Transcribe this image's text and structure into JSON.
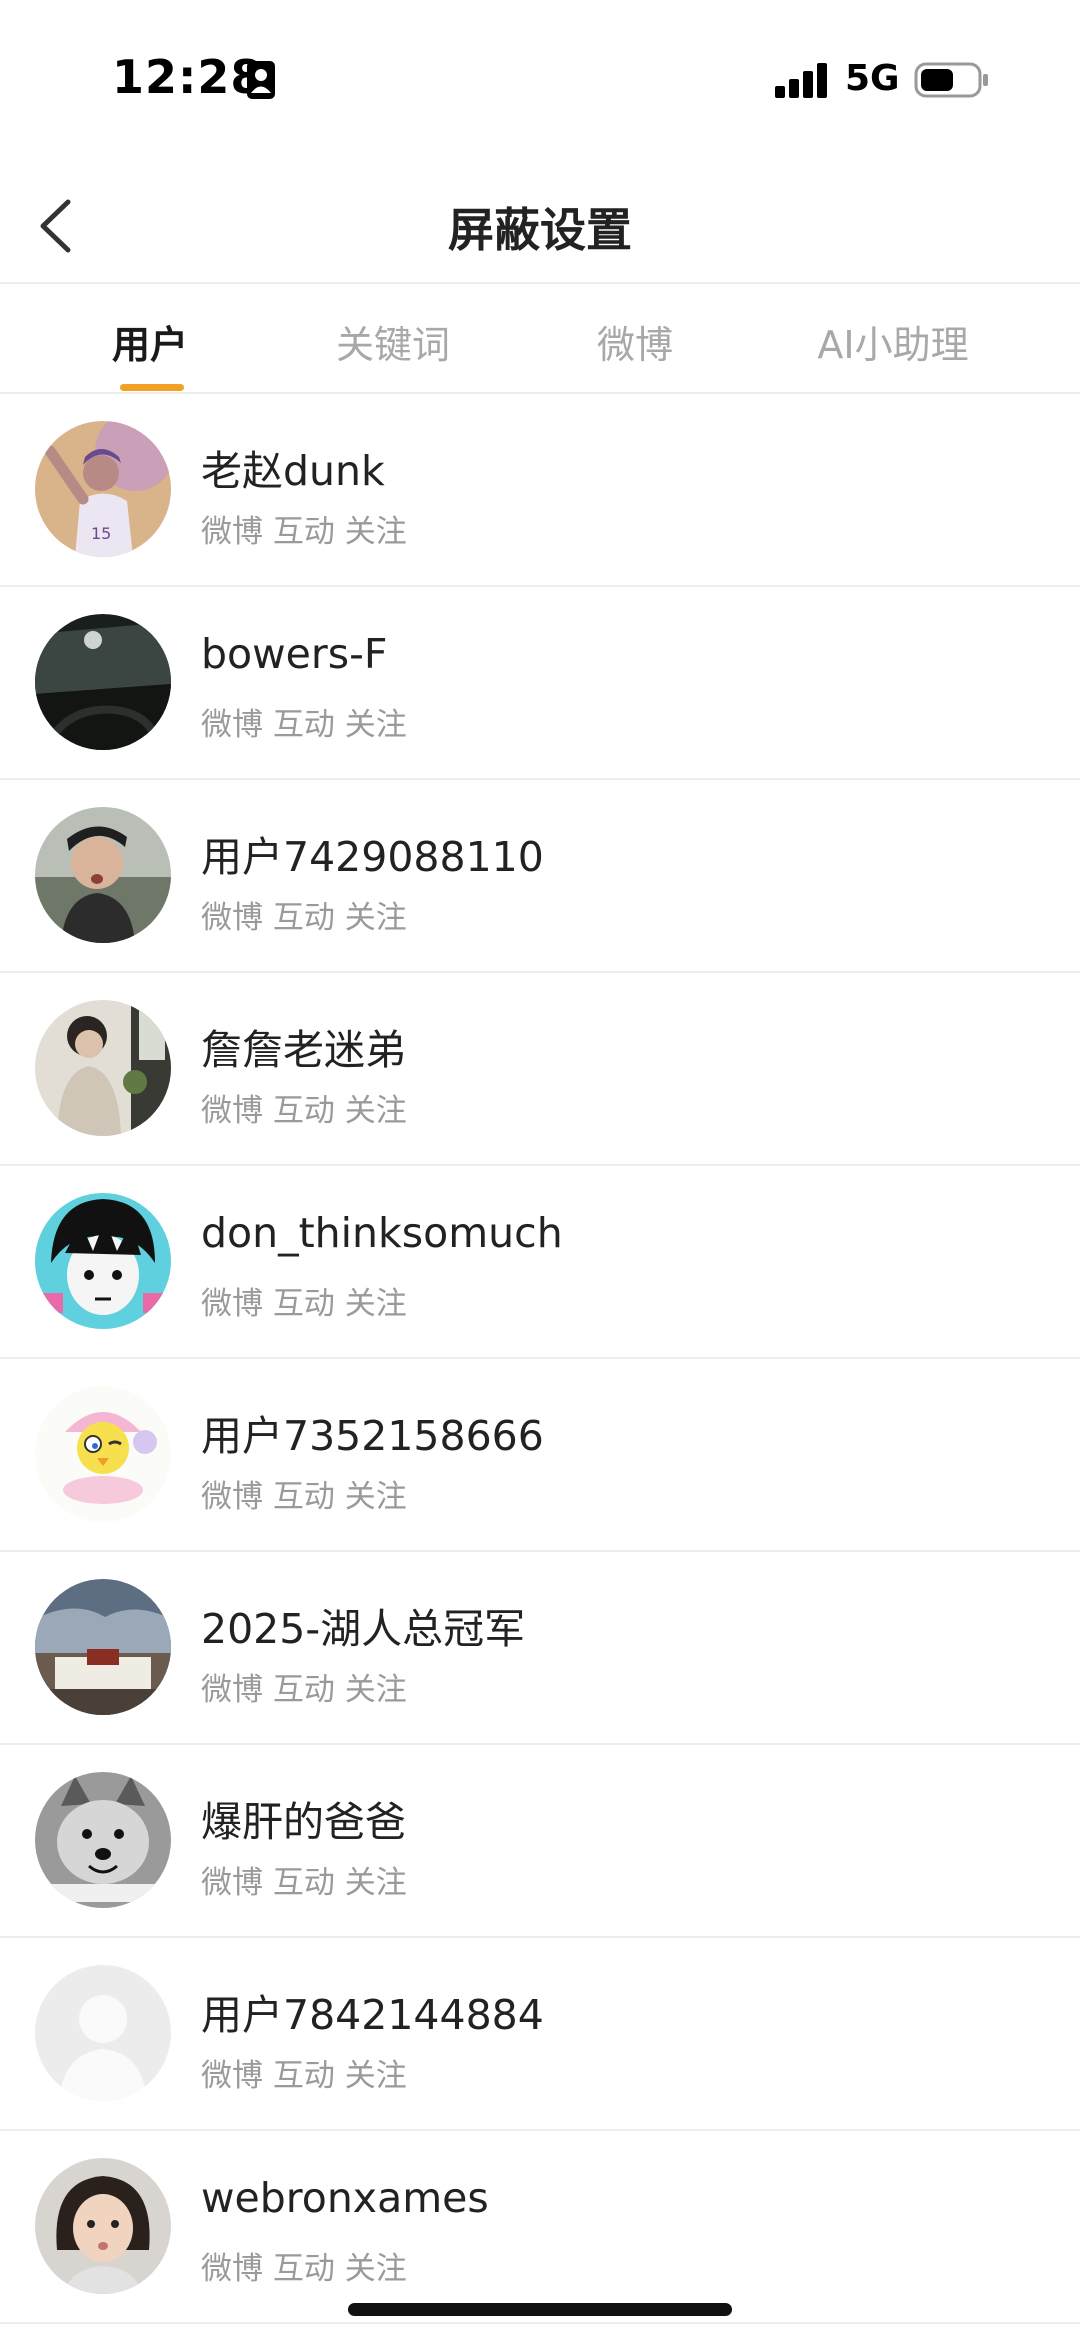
{
  "status_bar": {
    "time": "12:28",
    "network": "5G",
    "icons": [
      "contact-card-icon",
      "signal-bars-icon",
      "battery-icon"
    ]
  },
  "nav": {
    "title": "屏蔽设置",
    "back_icon": "chevron-left-icon"
  },
  "tabs": [
    {
      "label": "用户",
      "active": true
    },
    {
      "label": "关键词",
      "active": false
    },
    {
      "label": "微博",
      "active": false
    },
    {
      "label": "AI小助理",
      "active": false
    }
  ],
  "accent_color": "#f2a127",
  "users": [
    {
      "name": "老赵dunk",
      "meta": "微博 互动 关注",
      "avatar": "basketball-player-avatar"
    },
    {
      "name": "bowers-F",
      "meta": "微博 互动 关注",
      "avatar": "car-interior-avatar"
    },
    {
      "name": "用户7429088110",
      "meta": "微博 互动 关注",
      "avatar": "man-photo-avatar"
    },
    {
      "name": "詹詹老迷弟",
      "meta": "微博 互动 关注",
      "avatar": "woman-photo-avatar"
    },
    {
      "name": "don_thinksomuch",
      "meta": "微博 互动 关注",
      "avatar": "anime-character-avatar"
    },
    {
      "name": "用户7352158666",
      "meta": "微博 互动 关注",
      "avatar": "cartoon-bird-avatar"
    },
    {
      "name": "2025-湖人总冠军",
      "meta": "微博 互动 关注",
      "avatar": "palace-landscape-avatar"
    },
    {
      "name": "爆肝的爸爸",
      "meta": "微博 互动 关注",
      "avatar": "shiba-dog-avatar"
    },
    {
      "name": "用户7842144884",
      "meta": "微博 互动 关注",
      "avatar": "default-person-avatar"
    },
    {
      "name": "webronxames",
      "meta": "微博 互动 关注",
      "avatar": "child-photo-avatar"
    }
  ]
}
